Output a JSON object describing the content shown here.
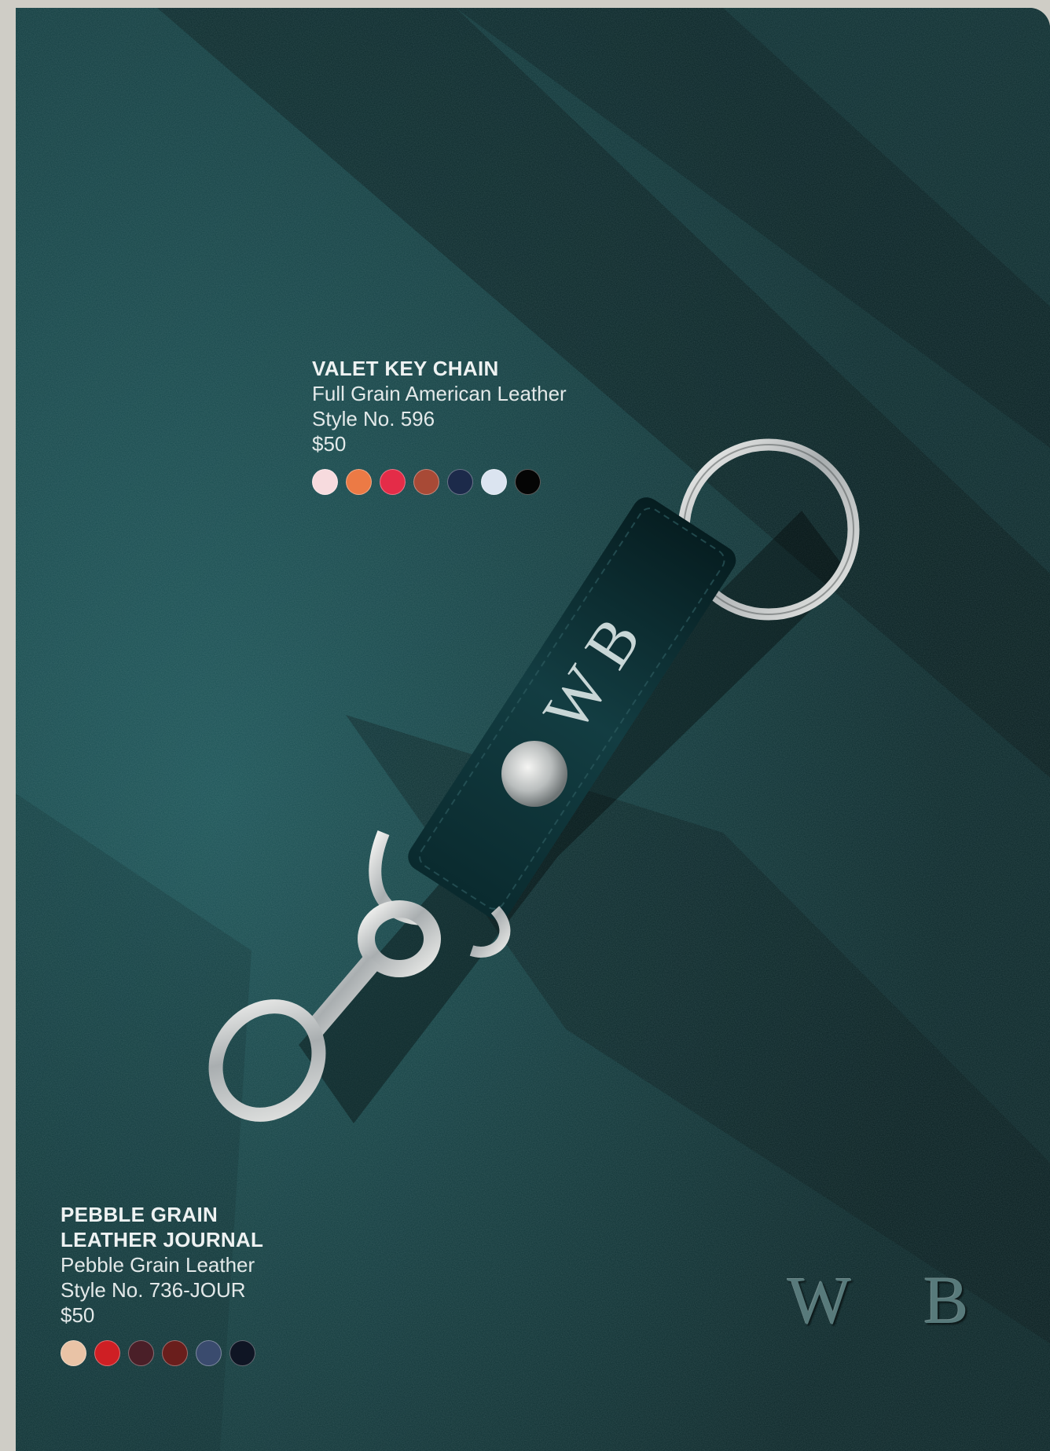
{
  "keychain": {
    "title": "VALET KEY CHAIN",
    "material": "Full Grain American Leather",
    "style": "Style No. 596",
    "price": "$50",
    "swatches": [
      "#f7dbde",
      "#ec7a45",
      "#e42c48",
      "#a84a36",
      "#1c2a4a",
      "#dbe4f0",
      "#050505"
    ]
  },
  "journal": {
    "title": "PEBBLE GRAIN\nLEATHER JOURNAL",
    "material": "Pebble Grain Leather",
    "style": "Style No. 736-JOUR",
    "price": "$50",
    "swatches": [
      "#e9c3a6",
      "#cf1f24",
      "#4a1f28",
      "#6a1e1c",
      "#3a4b6e",
      "#0f1524"
    ]
  },
  "monogram": {
    "strap": "W B",
    "cover": "W B"
  },
  "colors": {
    "leather": "#0f3b3e",
    "background": "#cfcdc6",
    "text": "#eef2f2"
  }
}
